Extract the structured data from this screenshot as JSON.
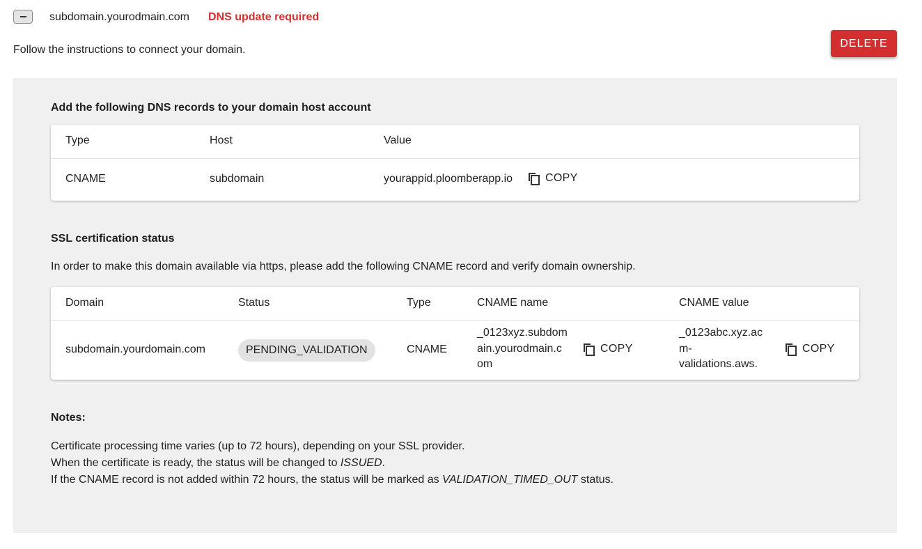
{
  "header": {
    "domain": "subdomain.yourodmain.com",
    "status": "DNS update required",
    "instructions": "Follow the instructions to connect your domain.",
    "delete_label": "DELETE"
  },
  "dns_section": {
    "title": "Add the following DNS records to your domain host account",
    "columns": [
      "Type",
      "Host",
      "Value"
    ],
    "row": {
      "type": "CNAME",
      "host": "subdomain",
      "value": "yourappid.ploomberapp.io",
      "copy_label": "COPY"
    }
  },
  "ssl_section": {
    "title": "SSL certification status",
    "description": "In order to make this domain available via https, please add the following CNAME record and verify domain ownership.",
    "columns": [
      "Domain",
      "Status",
      "Type",
      "CNAME name",
      "CNAME value"
    ],
    "row": {
      "domain": "subdomain.yourdomain.com",
      "status": "PENDING_VALIDATION",
      "type": "CNAME",
      "cname_name_lines": [
        "_0123xyz.subdom",
        "ain.yourodmain.c",
        "om"
      ],
      "cname_value_lines": [
        "_0123abc.xyz.ac",
        "m-",
        "validations.aws."
      ],
      "copy_label": "COPY"
    }
  },
  "notes": {
    "title": "Notes:",
    "line1": "Certificate processing time varies (up to 72 hours), depending on your SSL provider.",
    "line2_prefix": "When the certificate is ready, the status will be changed to ",
    "line2_em": "ISSUED",
    "line2_suffix": ".",
    "line3_prefix": "If the CNAME record is not added within 72 hours, the status will be marked as ",
    "line3_em": "VALIDATION_TIMED_OUT",
    "line3_suffix": " status."
  },
  "colors": {
    "accent_red": "#d32f2f",
    "panel_bg": "#f0f0f0",
    "chip_bg": "#e2e2e2"
  },
  "icons": [
    "minus-icon",
    "copy-icon"
  ]
}
